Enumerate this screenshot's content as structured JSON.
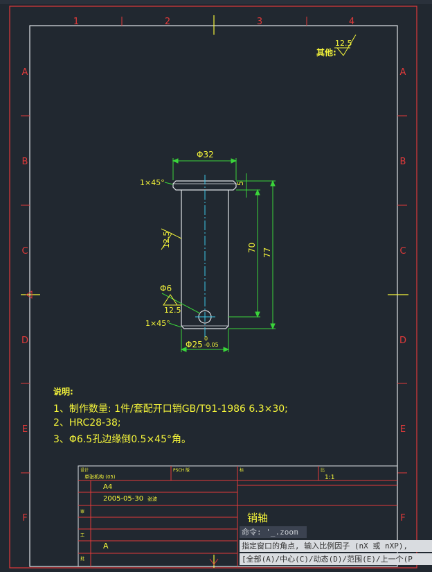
{
  "border": {
    "col_labels": [
      "1",
      "2",
      "3",
      "4"
    ],
    "row_labels": [
      "A",
      "B",
      "C",
      "D",
      "E",
      "F"
    ]
  },
  "roughness": {
    "other_label": "其他:",
    "value": "12.5"
  },
  "dims": {
    "top_dia": "Φ32",
    "chamfer_top": "1×45°",
    "head_h": "5",
    "len_70": "70",
    "len_77": "77",
    "rough_side": "12.5",
    "hole_dia": "Φ6",
    "rough_hole": "12.5",
    "chamfer_bot": "1×45°",
    "bot_dia_main": "Φ25",
    "bot_dia_tol_upper": "0",
    "bot_dia_tol_lower": "-0.05"
  },
  "notes": {
    "title": "说明:",
    "line1": "1、制作数量: 1件/套配开口销GB/T91-1986 6.3×30;",
    "line2": "2、HRC28-38;",
    "line3": "3、Φ6.5孔边缘倒0.5×45°角。"
  },
  "title_block": {
    "designer_label": "设计",
    "designer_value": "单张机构 (05)",
    "psch_label": "PSCH 版",
    "tab_label": "标",
    "scale_label": "比",
    "scale_value": "1:1",
    "paper_value": "A4",
    "date_value": "2005-05-30",
    "date_suffix": "张波",
    "row3_label": "审",
    "row4_label": "工",
    "row5_label": "批",
    "row6_label": "A",
    "part_name": "销轴"
  },
  "command": {
    "line1": "命令: '_.zoom",
    "line2": "指定窗口的角点, 输入比例因子 (nX 或 nXP),",
    "line3": "[全部(A)/中心(C)/动态(D)/范围(E)/上一个(P"
  },
  "colors": {
    "background": "#212830",
    "frame": "#e0e4e8",
    "border_red": "#e23a3a",
    "dim_green": "#3ad43a",
    "text_yellow": "#f5f53a",
    "center_cyan": "#3ac8e8",
    "title_red": "#e23a3a"
  }
}
